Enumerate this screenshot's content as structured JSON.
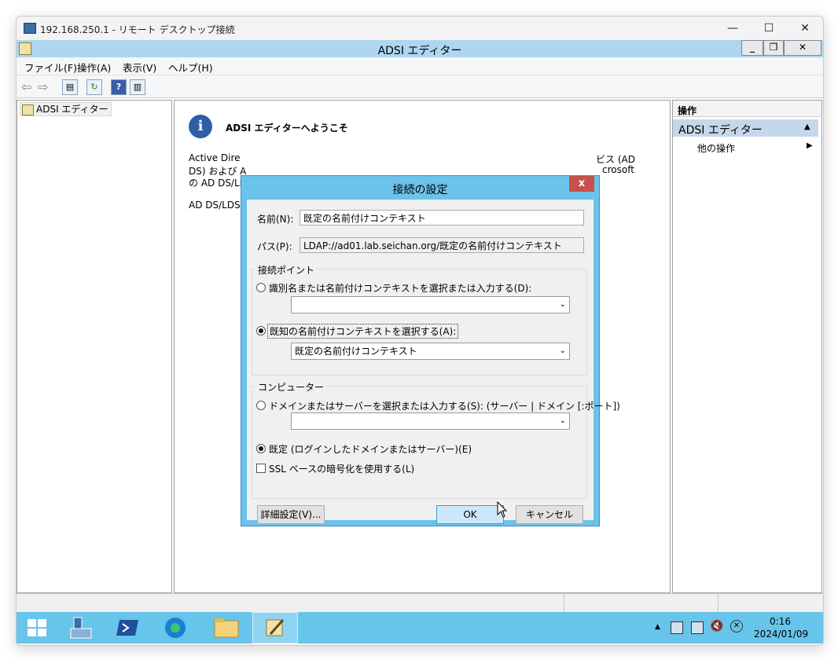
{
  "rdp": {
    "title": "192.168.250.1 - リモート デスクトップ接続",
    "min": "—",
    "max": "☐",
    "close": "✕"
  },
  "app": {
    "title": "ADSI エディター",
    "min": "_",
    "restore": "❐",
    "close": "✕"
  },
  "menu": [
    "ファイル(F)",
    "操作(A)",
    "表示(V)",
    "ヘルプ(H)"
  ],
  "tree": {
    "root": "ADSI エディター"
  },
  "welcome": {
    "heading": "ADSI エディターへようこそ",
    "para1_line1": "Active Dire",
    "para1_line2": "DS) および A",
    "para1_line3": "の AD DS/LI",
    "para1_right1": "ビス (AD",
    "para1_right2": "crosoft",
    "para2": "AD DS/LDS"
  },
  "actions": {
    "header": "操作",
    "section": "ADSI エディター",
    "more": "他の操作"
  },
  "dialog": {
    "title": "接続の設定",
    "close": "x",
    "name_label": "名前(N):",
    "name_value": "既定の名前付けコンテキスト",
    "path_label": "パス(P):",
    "path_value": "LDAP://ad01.lab.seichan.org/既定の名前付けコンテキスト",
    "conn_group": "接続ポイント",
    "radio1": "識別名または名前付けコンテキストを選択または入力する(D):",
    "combo1": "",
    "radio2": "既知の名前付けコンテキストを選択する(A):",
    "combo2": "既定の名前付けコンテキスト",
    "comp_group": "コンピューター",
    "radio3": "ドメインまたはサーバーを選択または入力する(S): (サーバー | ドメイン [:ポート])",
    "combo3": "",
    "radio4": "既定 (ログインしたドメインまたはサーバー)(E)",
    "ssl": "SSL ベースの暗号化を使用する(L)",
    "advanced": "詳細設定(V)...",
    "ok": "OK",
    "cancel": "キャンセル"
  },
  "tray": {
    "time": "0:16",
    "date": "2024/01/09"
  }
}
